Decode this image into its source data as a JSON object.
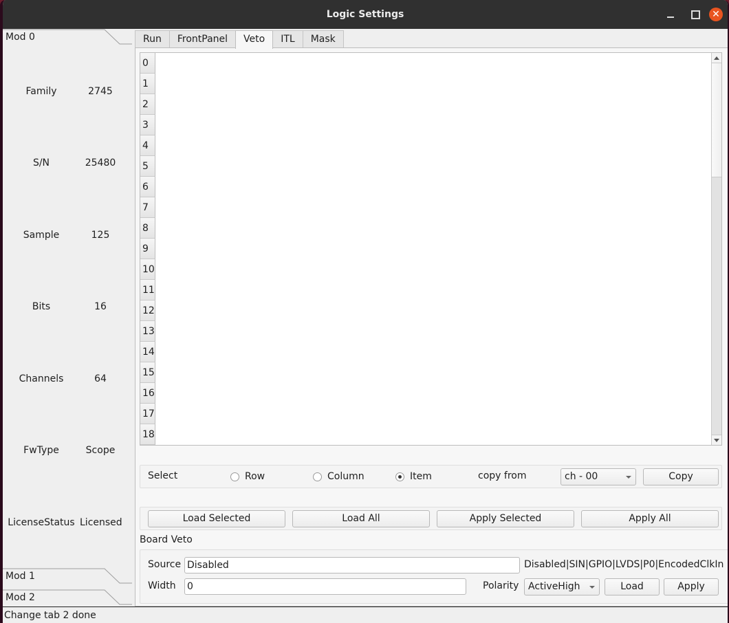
{
  "window": {
    "title": "Logic Settings",
    "minimize_label": "",
    "maximize_label": "",
    "close_label": "✕"
  },
  "toolbox": {
    "sections": [
      {
        "label": "Mod 0",
        "expanded": true
      },
      {
        "label": "Mod 1",
        "expanded": false
      },
      {
        "label": "Mod 2",
        "expanded": false
      }
    ],
    "info": [
      {
        "key": "Family",
        "value": "2745"
      },
      {
        "key": "S/N",
        "value": "25480"
      },
      {
        "key": "Sample",
        "value": "125"
      },
      {
        "key": "Bits",
        "value": "16"
      },
      {
        "key": "Channels",
        "value": "64"
      },
      {
        "key": "FwType",
        "value": "Scope"
      },
      {
        "key": "LicenseStatus",
        "value": "Licensed"
      }
    ]
  },
  "tabs": [
    {
      "label": "Run",
      "active": false
    },
    {
      "label": "FrontPanel",
      "active": false
    },
    {
      "label": "Veto",
      "active": true
    },
    {
      "label": "ITL",
      "active": false
    },
    {
      "label": "Mask",
      "active": false
    }
  ],
  "table": {
    "row_headers": [
      "0",
      "1",
      "2",
      "3",
      "4",
      "5",
      "6",
      "7",
      "8",
      "9",
      "10",
      "11",
      "12",
      "13",
      "14",
      "15",
      "16",
      "17",
      "18"
    ]
  },
  "select_group": {
    "label": "Select",
    "options": [
      {
        "label": "Row",
        "checked": false
      },
      {
        "label": "Column",
        "checked": false
      },
      {
        "label": "Item",
        "checked": true
      }
    ],
    "copy_from_label": "copy from",
    "copy_from_value": "ch - 00",
    "copy_button": "Copy"
  },
  "actions": {
    "load_selected": "Load Selected",
    "load_all": "Load All",
    "apply_selected": "Apply Selected",
    "apply_all": "Apply All"
  },
  "board_veto": {
    "title": "Board Veto",
    "source_label": "Source",
    "source_value": "Disabled",
    "source_hint": "Disabled|SIN|GPIO|LVDS|P0|EncodedClkIn",
    "width_label": "Width",
    "width_value": "0",
    "polarity_label": "Polarity",
    "polarity_value": "ActiveHigh",
    "load_button": "Load",
    "apply_button": "Apply"
  },
  "status": {
    "message": "Change tab 2 done"
  }
}
